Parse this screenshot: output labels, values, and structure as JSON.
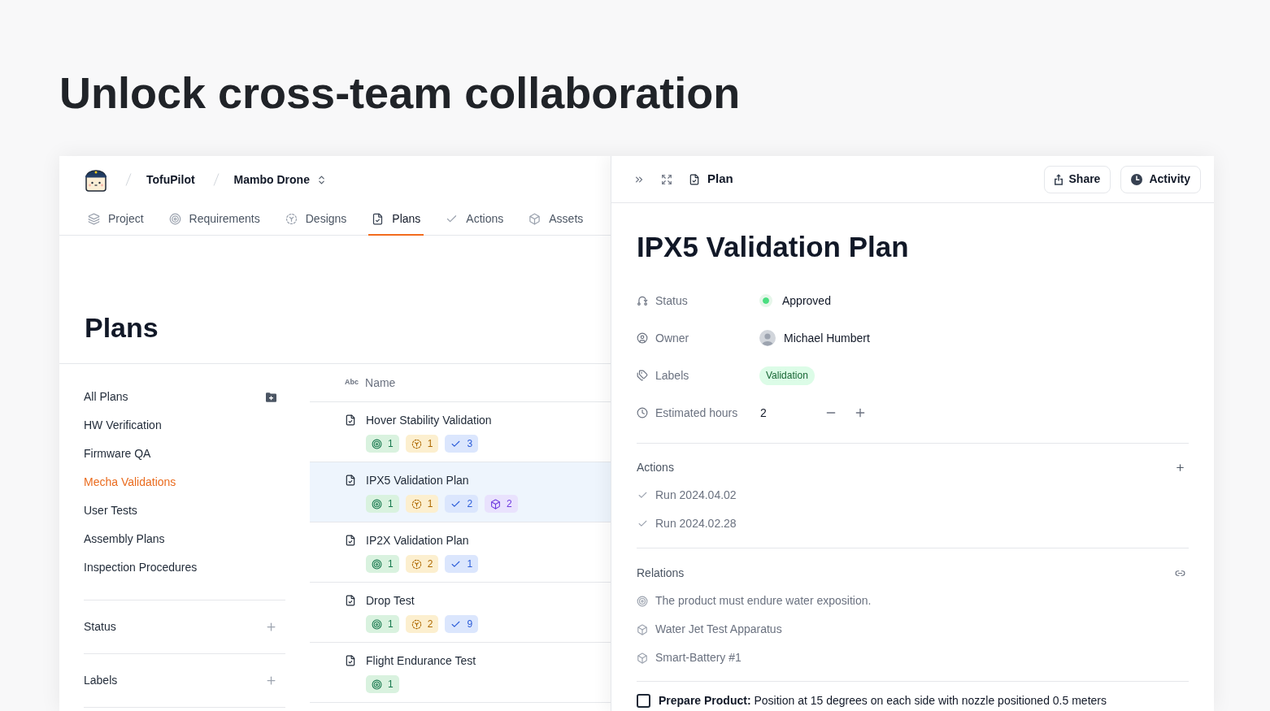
{
  "headline": "Unlock cross-team collaboration",
  "breadcrumb": {
    "workspace": "TofuPilot",
    "project": "Mambo Drone"
  },
  "tabs": [
    {
      "label": "Project",
      "kind": "project",
      "selected": false
    },
    {
      "label": "Requirements",
      "kind": "requirements",
      "selected": false
    },
    {
      "label": "Designs",
      "kind": "designs",
      "selected": false
    },
    {
      "label": "Plans",
      "kind": "plans",
      "selected": true
    },
    {
      "label": "Actions",
      "kind": "actions",
      "selected": false
    },
    {
      "label": "Assets",
      "kind": "assets",
      "selected": false
    }
  ],
  "page_title": "Plans",
  "sidebar": {
    "items": [
      {
        "label": "All Plans",
        "kind": "all",
        "selected": false
      },
      {
        "label": "HW Verification",
        "kind": "folder",
        "selected": false
      },
      {
        "label": "Firmware QA",
        "kind": "folder",
        "selected": false
      },
      {
        "label": "Mecha Validations",
        "kind": "folder",
        "selected": true
      },
      {
        "label": "User Tests",
        "kind": "folder",
        "selected": false
      },
      {
        "label": "Assembly Plans",
        "kind": "folder",
        "selected": false
      },
      {
        "label": "Inspection Procedures",
        "kind": "folder",
        "selected": false
      }
    ],
    "filters": [
      {
        "label": "Status"
      },
      {
        "label": "Labels"
      }
    ]
  },
  "table": {
    "columns": [
      {
        "type_label": "Abc",
        "label": "Name"
      }
    ],
    "rows": [
      {
        "name": "Hover Stability Validation",
        "selected": false,
        "badges": [
          {
            "kind": "requirement",
            "count": "1"
          },
          {
            "kind": "design",
            "count": "1"
          },
          {
            "kind": "action",
            "count": "3"
          }
        ]
      },
      {
        "name": "IPX5 Validation Plan",
        "selected": true,
        "badges": [
          {
            "kind": "requirement",
            "count": "1"
          },
          {
            "kind": "design",
            "count": "1"
          },
          {
            "kind": "action",
            "count": "2"
          },
          {
            "kind": "asset",
            "count": "2"
          }
        ]
      },
      {
        "name": "IP2X Validation Plan",
        "selected": false,
        "badges": [
          {
            "kind": "requirement",
            "count": "1"
          },
          {
            "kind": "design",
            "count": "2"
          },
          {
            "kind": "action",
            "count": "1"
          }
        ]
      },
      {
        "name": "Drop Test",
        "selected": false,
        "badges": [
          {
            "kind": "requirement",
            "count": "1"
          },
          {
            "kind": "design",
            "count": "2"
          },
          {
            "kind": "action",
            "count": "9"
          }
        ]
      },
      {
        "name": "Flight Endurance Test",
        "selected": false,
        "badges": [
          {
            "kind": "requirement",
            "count": "1"
          }
        ]
      }
    ]
  },
  "detail": {
    "header_title": "Plan",
    "buttons": [
      {
        "label": "Share",
        "kind": "share"
      },
      {
        "label": "Activity",
        "kind": "activity"
      }
    ],
    "title": "IPX5 Validation Plan",
    "properties": [
      {
        "kind": "status",
        "label": "Status",
        "value": "Approved",
        "color": "#4ade80"
      },
      {
        "kind": "owner",
        "label": "Owner",
        "value": "Michael Humbert"
      },
      {
        "kind": "labels",
        "label": "Labels",
        "tags": [
          {
            "label": "Validation"
          }
        ]
      },
      {
        "kind": "hours",
        "label": "Estimated hours",
        "value": "2"
      }
    ],
    "actions": {
      "title": "Actions",
      "items": [
        {
          "label": "Run 2024.04.02"
        },
        {
          "label": "Run 2024.02.28"
        }
      ]
    },
    "relations": {
      "title": "Relations",
      "items": [
        {
          "kind": "requirement",
          "label": "The product must endure water exposition."
        },
        {
          "kind": "asset",
          "label": "Water Jet Test Apparatus"
        },
        {
          "kind": "asset",
          "label": "Smart-Battery #1"
        }
      ]
    },
    "steps": [
      {
        "text": "**Prepare Product:** Position at 15 degrees on each side with nozzle positioned 0.5 meters",
        "checked": false
      }
    ]
  }
}
